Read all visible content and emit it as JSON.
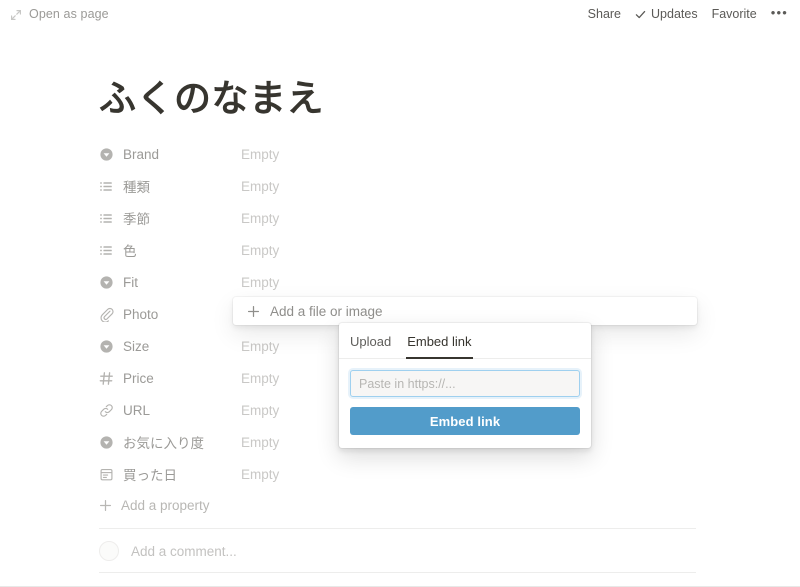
{
  "topbar": {
    "open_as_page": "Open as page",
    "open_as_page_icon": "expand-diagonal-icon",
    "share": "Share",
    "updates": "Updates",
    "updates_icon": "check-icon",
    "favorite": "Favorite",
    "more_icon": "ellipsis-icon",
    "more": "•••"
  },
  "page": {
    "title": "ふくのなまえ",
    "add_property_label": "Add a property",
    "add_property_icon": "plus-icon",
    "comment_placeholder": "Add a comment...",
    "avatar_icon": "avatar-circle"
  },
  "properties": [
    {
      "name": "Brand",
      "icon": "select-icon",
      "value": "Empty"
    },
    {
      "name": "種類",
      "icon": "multi-select-icon",
      "value": "Empty"
    },
    {
      "name": "季節",
      "icon": "multi-select-icon",
      "value": "Empty"
    },
    {
      "name": "色",
      "icon": "multi-select-icon",
      "value": "Empty"
    },
    {
      "name": "Fit",
      "icon": "select-icon",
      "value": "Empty"
    },
    {
      "name": "Photo",
      "icon": "paperclip-icon",
      "value": ""
    },
    {
      "name": "Size",
      "icon": "select-icon",
      "value": "Empty"
    },
    {
      "name": "Price",
      "icon": "hash-icon",
      "value": "Empty"
    },
    {
      "name": "URL",
      "icon": "link-icon",
      "value": "Empty"
    },
    {
      "name": "お気に入り度",
      "icon": "select-icon",
      "value": "Empty"
    },
    {
      "name": "買った日",
      "icon": "calendar-icon",
      "value": "Empty"
    }
  ],
  "file_bar": {
    "label": "Add a file or image",
    "icon": "plus-icon"
  },
  "popup": {
    "tabs": [
      {
        "label": "Upload",
        "active": false
      },
      {
        "label": "Embed link",
        "active": true
      }
    ],
    "input_placeholder": "Paste in https://...",
    "input_value": "",
    "submit_label": "Embed link",
    "accent_color": "#529cca",
    "input_border_color": "#9fd0ef"
  }
}
